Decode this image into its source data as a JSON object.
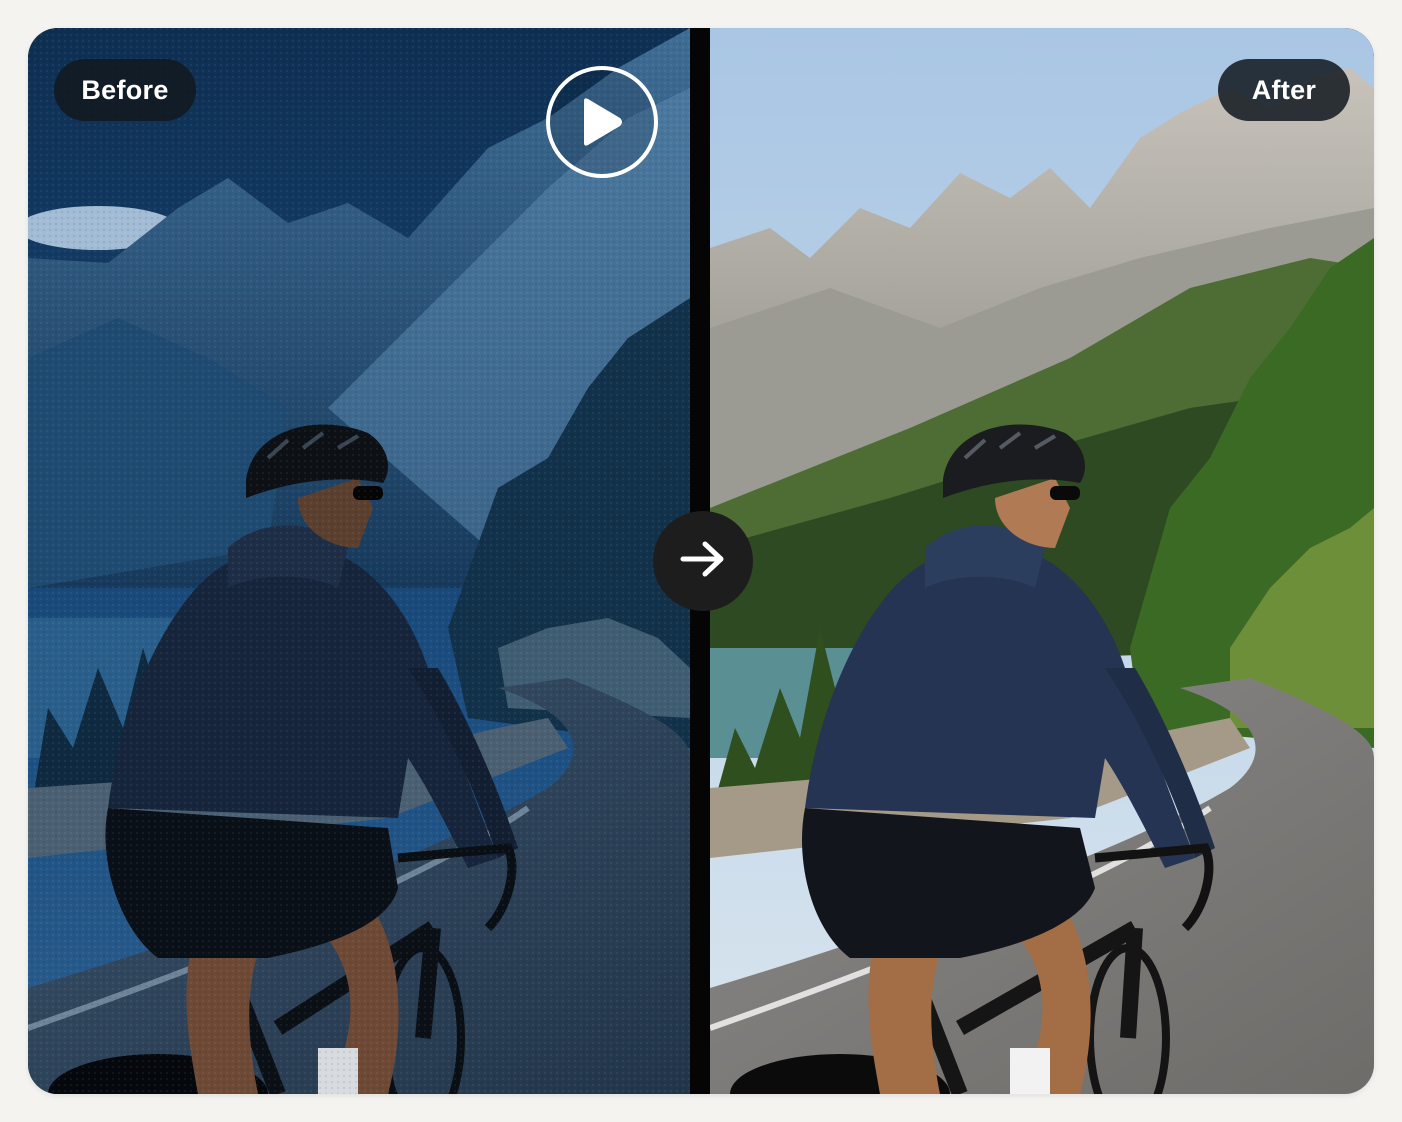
{
  "comparison": {
    "before_label": "Before",
    "after_label": "After"
  },
  "controls": {
    "play_icon": "play-icon",
    "arrow_icon": "arrow-right-icon"
  },
  "colors": {
    "background": "#f4f3f0",
    "divider": "#050505",
    "label_bg": "#121820",
    "arrow_button_bg": "#1d1d1d"
  }
}
